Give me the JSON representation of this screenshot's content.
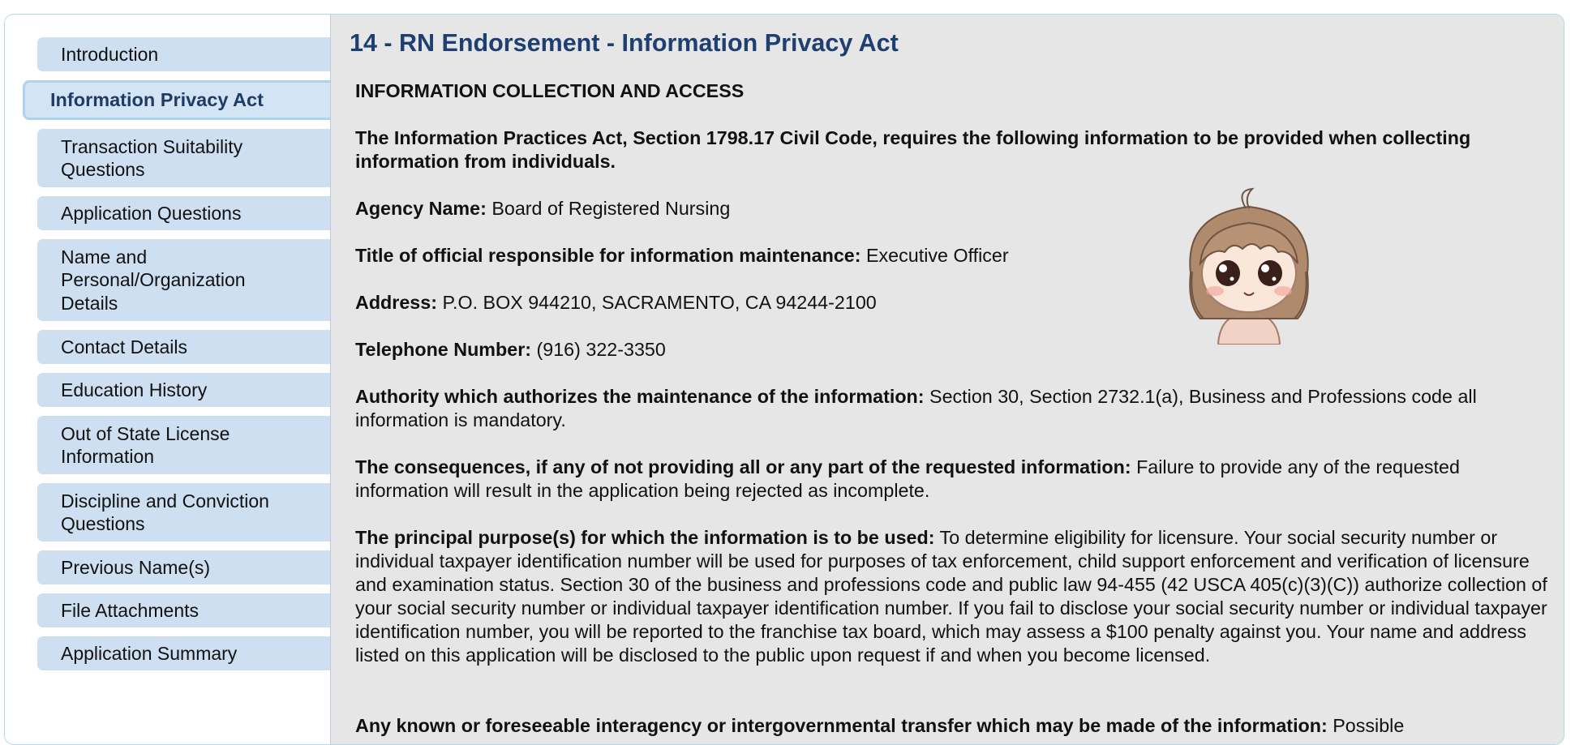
{
  "sidebar": {
    "items": [
      {
        "label": "Introduction"
      },
      {
        "label": "Information Privacy Act"
      },
      {
        "label": "Transaction Suitability Questions"
      },
      {
        "label": "Application Questions"
      },
      {
        "label": "Name and Personal/Organization Details"
      },
      {
        "label": "Contact Details"
      },
      {
        "label": "Education History"
      },
      {
        "label": "Out of State License Information"
      },
      {
        "label": "Discipline and Conviction Questions"
      },
      {
        "label": "Previous Name(s)"
      },
      {
        "label": "File Attachments"
      },
      {
        "label": "Application Summary"
      }
    ],
    "active_item": "Information Privacy Act"
  },
  "main": {
    "title": "14 - RN Endorsement - Information Privacy Act",
    "section_heading": "INFORMATION COLLECTION AND ACCESS",
    "intro": "The Information Practices Act, Section 1798.17 Civil Code, requires the following information to be provided when collecting information from individuals.",
    "fields": [
      {
        "label": "Agency Name:",
        "value": "Board of Registered Nursing"
      },
      {
        "label": "Title of official responsible for information maintenance:",
        "value": "Executive Officer"
      },
      {
        "label": "Address:",
        "value": "P.O. BOX 944210, SACRAMENTO, CA 94244-2100"
      },
      {
        "label": "Telephone Number:",
        "value": "(916) 322-3350"
      },
      {
        "label": "Authority which authorizes the maintenance of the information:",
        "value": "Section 30, Section 2732.1(a), Business and Professions code all information is mandatory."
      },
      {
        "label": "The consequences, if any of not providing all or any part of the requested information:",
        "value": "Failure to provide any of the requested information will result in the application being rejected as incomplete."
      },
      {
        "label": "The principal purpose(s) for which the information is to be used:",
        "value": "To determine eligibility for licensure. Your social security number or individual taxpayer identification number will be used for purposes of tax enforcement, child support enforcement and verification of licensure and examination status. Section 30 of the business and professions code and public law 94-455 (42 USCA 405(c)(3)(C)) authorize collection of your social security number or individual taxpayer identification number. If you fail to disclose your social security number or individual taxpayer identification number, you will be reported to the franchise tax board, which may assess a $100 penalty against you. Your name and address listed on this application will be disclosed to the public upon request if and when you become licensed."
      },
      {
        "label": "Any known or foreseeable interagency or intergovernmental transfer which may be made of the information:",
        "value": "Possible"
      }
    ]
  },
  "colors": {
    "title": "#1d3f72",
    "nav_bg": "#cddff0",
    "content_bg": "#e6e6e6"
  },
  "icons": {
    "sticker": "chibi-girl-sticker"
  }
}
